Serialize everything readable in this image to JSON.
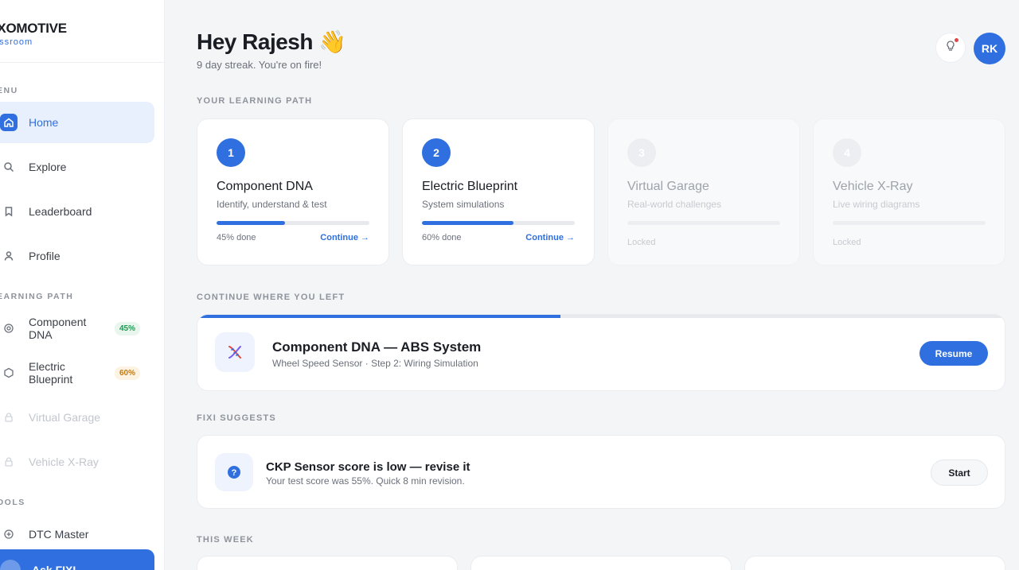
{
  "brand": {
    "name": "IXOMOTIVE",
    "sub": "assroom"
  },
  "sidebar": {
    "menu_label": "ENU",
    "menu": [
      {
        "label": "Home",
        "icon": "home-icon",
        "active": true
      },
      {
        "label": "Explore",
        "icon": "search-icon"
      },
      {
        "label": "Leaderboard",
        "icon": "bookmark-icon"
      },
      {
        "label": "Profile",
        "icon": "user-icon"
      }
    ],
    "path_label": "EARNING PATH",
    "path": [
      {
        "label": "Component DNA",
        "badge": "45%",
        "icon": "target-icon"
      },
      {
        "label": "Electric Blueprint",
        "badge": "60%",
        "icon": "hexagon-icon"
      },
      {
        "label": "Virtual Garage",
        "icon": "lock-icon"
      },
      {
        "label": "Vehicle X-Ray",
        "icon": "lock-icon"
      }
    ],
    "tools_label": "OOLS",
    "tools": [
      {
        "label": "DTC Master",
        "icon": "plus-circle-icon"
      }
    ],
    "ask": "Ask FIXI"
  },
  "header": {
    "greeting": "Hey Rajesh 👋",
    "streak": "9 day streak. You're on fire!",
    "avatar": "RK",
    "bell_icon": "bulb-icon"
  },
  "sections": {
    "path": "YOUR LEARNING PATH",
    "continue": "CONTINUE WHERE YOU LEFT",
    "suggest": "FIXI SUGGESTS",
    "week": "THIS WEEK"
  },
  "path_cards": [
    {
      "num": "1",
      "title": "Component DNA",
      "sub": "Identify, understand & test",
      "progress": 45,
      "done": "45% done",
      "cta": "Continue →"
    },
    {
      "num": "2",
      "title": "Electric Blueprint",
      "sub": "System simulations",
      "progress": 60,
      "done": "60% done",
      "cta": "Continue →"
    },
    {
      "num": "3",
      "title": "Virtual Garage",
      "sub": "Real-world challenges",
      "progress": 0,
      "done": "Locked"
    },
    {
      "num": "4",
      "title": "Vehicle X-Ray",
      "sub": "Live wiring diagrams",
      "progress": 0,
      "done": "Locked"
    }
  ],
  "continue": {
    "title": "Component DNA — ABS System",
    "sub": "Wheel Speed Sensor · Step 2: Wiring Simulation",
    "progress": 45,
    "button": "Resume",
    "icon": "dna-icon"
  },
  "suggest": {
    "title": "CKP Sensor score is low — revise it",
    "sub": "Your test score was 55%. Quick 8 min revision.",
    "button": "Start",
    "icon": "question-icon"
  },
  "colors": {
    "accent": "#2f6fe0",
    "green": "#1b9a52",
    "orange": "#c27a12"
  }
}
